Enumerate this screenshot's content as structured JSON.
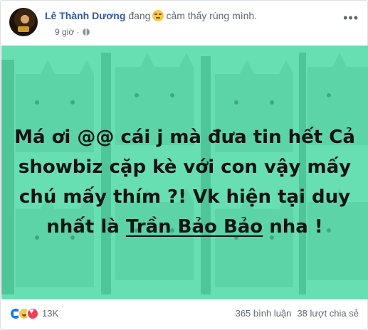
{
  "post": {
    "author": "Lê Thành Dương",
    "feeling_prefix": "đang",
    "feeling_emoji": "relieved-face-icon",
    "feeling_text": "cảm thấy rùng mình.",
    "time": "9 giờ",
    "audience_icon": "globe-icon",
    "more_label": "•••"
  },
  "image": {
    "background": "#68dfb3",
    "text_before": "Má ơi @@ cái j mà đưa tin hết Cả showbiz cặp kè với con vậy mấy chú mấy thím ?! Vk hiện tại duy nhất là ",
    "mention": "Trần Bảo Bảo",
    "text_after": " nha !"
  },
  "engagement": {
    "reactions": [
      "like-icon",
      "haha-icon",
      "love-icon"
    ],
    "reaction_count": "13K",
    "comments": "365 bình luận",
    "shares": "38 lượt chia sẻ"
  },
  "colors": {
    "link": "#385898",
    "muted": "#616770",
    "border": "#dddfe2"
  }
}
